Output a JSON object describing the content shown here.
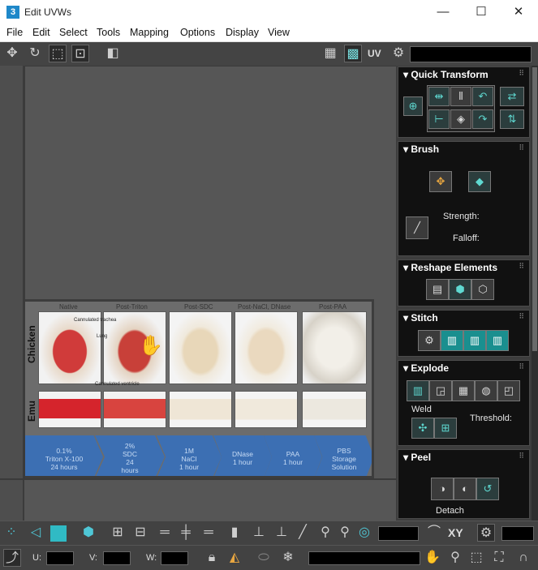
{
  "window": {
    "app_badge": "3",
    "title": "Edit UVWs",
    "minimize": "—",
    "maximize": "☐",
    "close": "✕"
  },
  "menu": [
    "File",
    "Edit",
    "Select",
    "Tools",
    "Mapping",
    "Options",
    "Display",
    "View"
  ],
  "top_toolbar": {
    "uv_label": "UV"
  },
  "texture": {
    "columns": [
      "Native",
      "Post-Triton",
      "Post-SDC",
      "Post-NaCl, DNase",
      "Post-PAA"
    ],
    "rows": [
      "Chicken",
      "Emu"
    ],
    "annotations": [
      "Cannulated trachea",
      "Lung",
      "Cannulated ventricle"
    ],
    "steps": [
      [
        "0.1%",
        "Triton X-100",
        "24 hours"
      ],
      [
        "2%",
        "SDC",
        "24",
        "hours"
      ],
      [
        "1M",
        "NaCl",
        "1 hour"
      ],
      [
        "DNase",
        "1 hour"
      ],
      [
        "PAA",
        "1 hour"
      ],
      [
        "PBS",
        "Storage",
        "Solution"
      ]
    ],
    "colors": {
      "arrow_blue": "#3c6fb3",
      "tissue_red": "#c8423f",
      "tissue_white": "#e8e2d2"
    }
  },
  "panel": {
    "quick_transform": {
      "title": "Quick Transform"
    },
    "brush": {
      "title": "Brush",
      "strength_label": "Strength:",
      "falloff_label": "Falloff:"
    },
    "reshape": {
      "title": "Reshape Elements"
    },
    "stitch": {
      "title": "Stitch"
    },
    "explode": {
      "title": "Explode",
      "weld_label": "Weld",
      "threshold_label": "Threshold:"
    },
    "peel": {
      "title": "Peel",
      "detach_label": "Detach"
    }
  },
  "bottom_toolbar": {
    "xy_label": "XY",
    "u_label": "U:",
    "v_label": "V:",
    "w_label": "W:"
  }
}
